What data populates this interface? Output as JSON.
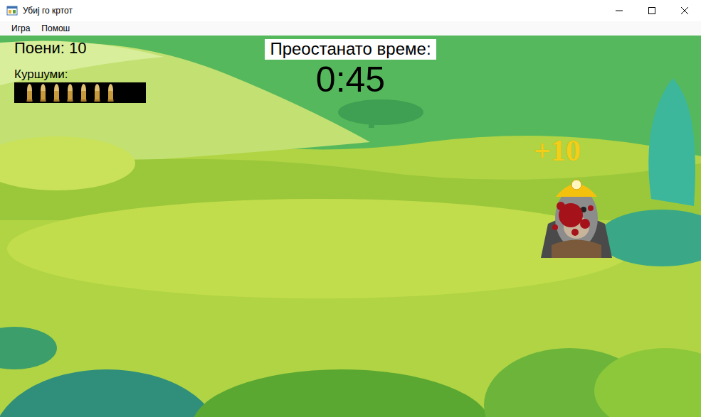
{
  "window": {
    "title": "Убиј го кртот"
  },
  "menu": [
    {
      "label": "Игра"
    },
    {
      "label": "Помош"
    }
  ],
  "hud": {
    "score": "Поени: 10",
    "bullets_label": "Куршуми:",
    "bullets": 7,
    "time_label": "Преостанато време:",
    "time": "0:45"
  },
  "mole": {
    "hit": true,
    "points_popup": "+10"
  }
}
